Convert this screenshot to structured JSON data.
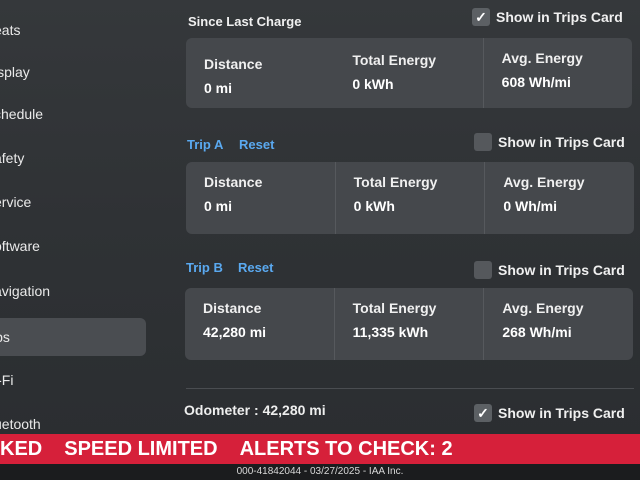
{
  "sidebar": {
    "items": [
      {
        "label": "eats"
      },
      {
        "label": "isplay"
      },
      {
        "label": "chedule"
      },
      {
        "label": "afety"
      },
      {
        "label": "ervice"
      },
      {
        "label": "oftware"
      },
      {
        "label": "avigation"
      },
      {
        "label": "ips"
      },
      {
        "label": "i-Fi"
      },
      {
        "label": "uetooth"
      }
    ],
    "active_index": 7
  },
  "since_last_charge": {
    "title": "Since Last Charge",
    "show_in_trips_card": {
      "label": "Show in Trips Card",
      "checked": true
    },
    "distance_label": "Distance",
    "distance_value": "0 mi",
    "energy_label": "Total Energy",
    "energy_value": "0 kWh",
    "avg_label": "Avg. Energy",
    "avg_value": "608 Wh/mi"
  },
  "trip_a": {
    "title": "Trip A",
    "reset_label": "Reset",
    "show_in_trips_card": {
      "label": "Show in Trips Card",
      "checked": false
    },
    "distance_label": "Distance",
    "distance_value": "0 mi",
    "energy_label": "Total Energy",
    "energy_value": "0 kWh",
    "avg_label": "Avg. Energy",
    "avg_value": "0 Wh/mi"
  },
  "trip_b": {
    "title": "Trip B",
    "reset_label": "Reset",
    "show_in_trips_card": {
      "label": "Show in Trips Card",
      "checked": false
    },
    "distance_label": "Distance",
    "distance_value": "42,280 mi",
    "energy_label": "Total Energy",
    "energy_value": "11,335 kWh",
    "avg_label": "Avg. Energy",
    "avg_value": "268 Wh/mi"
  },
  "odometer": {
    "text": "Odometer :  42,280 mi",
    "show_in_trips_card": {
      "label": "Show in Trips Card",
      "checked": true
    }
  },
  "banner": {
    "part1": "KED",
    "part2": "SPEED LIMITED",
    "part3": "ALERTS TO CHECK: 2",
    "color": "#d6203a"
  },
  "footer": {
    "text": "000-41842044 - 03/27/2025 - IAA Inc."
  },
  "icons": {
    "checkmark": "checkmark-icon"
  }
}
